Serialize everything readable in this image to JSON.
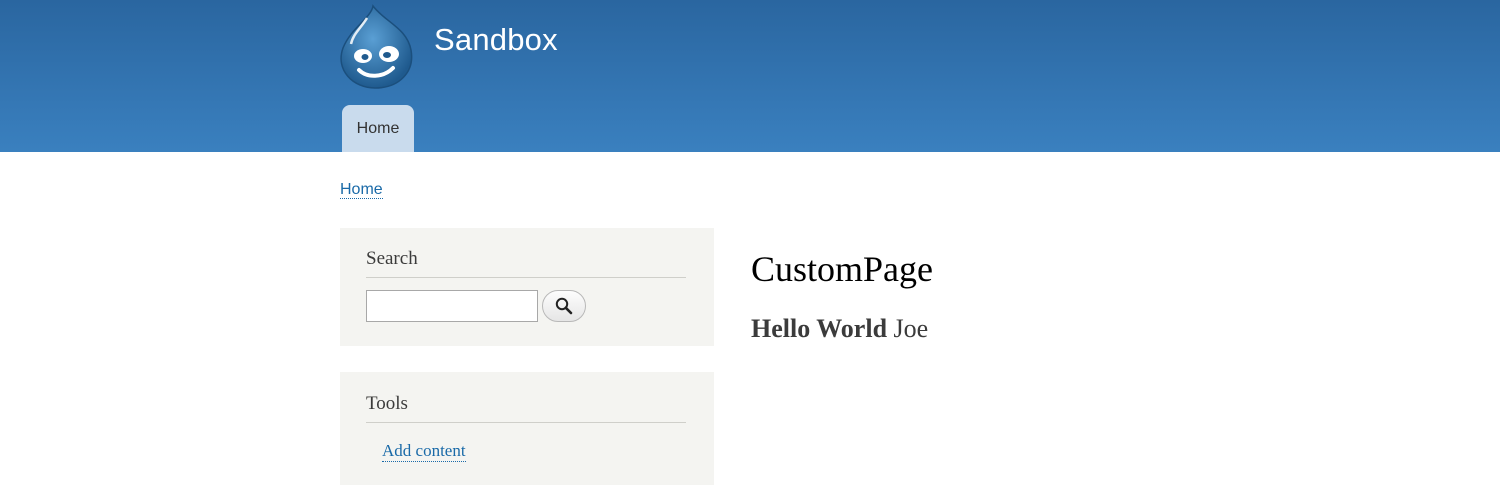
{
  "header": {
    "site_name": "Sandbox",
    "logo_icon": "drupal-drop-icon",
    "background_color": "#2f6ea8"
  },
  "nav": {
    "tabs": [
      {
        "label": "Home",
        "active": true
      }
    ]
  },
  "breadcrumb": {
    "items": [
      "Home"
    ]
  },
  "sidebar": {
    "search_block": {
      "title": "Search",
      "input_value": "",
      "button_icon": "search-icon"
    },
    "tools_block": {
      "title": "Tools",
      "links": [
        "Add content"
      ]
    }
  },
  "main": {
    "title": "CustomPage",
    "body_bold": "Hello World",
    "body_rest": "Joe"
  },
  "colors": {
    "link": "#1a6aa8",
    "block_background": "#f4f4f1",
    "active_tab": "#c9dbed"
  }
}
